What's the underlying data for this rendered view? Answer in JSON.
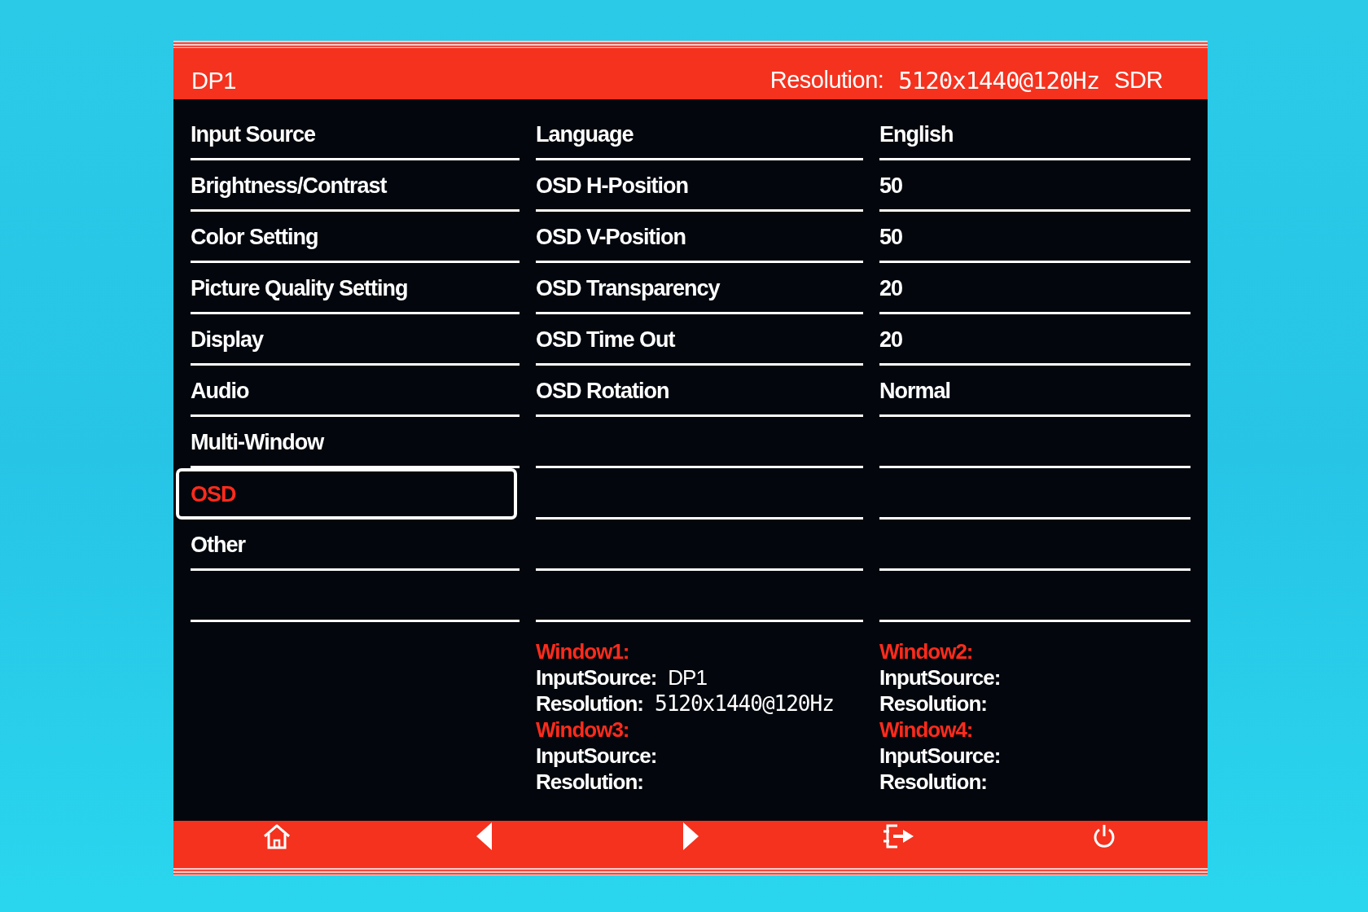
{
  "header": {
    "input": "DP1",
    "resolution_label": "Resolution:",
    "resolution_value": "5120x1440@120Hz",
    "dynamic_range": "SDR"
  },
  "main_menu": [
    {
      "label": "Input Source",
      "selected": false
    },
    {
      "label": "Brightness/Contrast",
      "selected": false
    },
    {
      "label": "Color Setting",
      "selected": false
    },
    {
      "label": "Picture Quality Setting",
      "selected": false
    },
    {
      "label": "Display",
      "selected": false
    },
    {
      "label": "Audio",
      "selected": false
    },
    {
      "label": "Multi-Window",
      "selected": false
    },
    {
      "label": "OSD",
      "selected": true
    },
    {
      "label": "Other",
      "selected": false
    }
  ],
  "osd_settings": [
    {
      "label": "Language",
      "value": "English"
    },
    {
      "label": "OSD H-Position",
      "value": "50"
    },
    {
      "label": "OSD V-Position",
      "value": "50"
    },
    {
      "label": "OSD Transparency",
      "value": "20"
    },
    {
      "label": "OSD Time Out",
      "value": "20"
    },
    {
      "label": "OSD Rotation",
      "value": "Normal"
    }
  ],
  "windows": [
    {
      "title": "Window1:",
      "input_source_label": "InputSource:",
      "input_source": "DP1",
      "resolution_label": "Resolution:",
      "resolution": "5120x1440@120Hz"
    },
    {
      "title": "Window2:",
      "input_source_label": "InputSource:",
      "resolution_label": "Resolution:"
    },
    {
      "title": "Window3:",
      "input_source_label": "InputSource:",
      "resolution_label": "Resolution:"
    },
    {
      "title": "Window4:",
      "input_source_label": "InputSource:",
      "resolution_label": "Resolution:"
    }
  ],
  "footer_buttons": [
    {
      "kind": "home"
    },
    {
      "kind": "left"
    },
    {
      "kind": "right"
    },
    {
      "kind": "exit"
    },
    {
      "kind": "power"
    }
  ]
}
